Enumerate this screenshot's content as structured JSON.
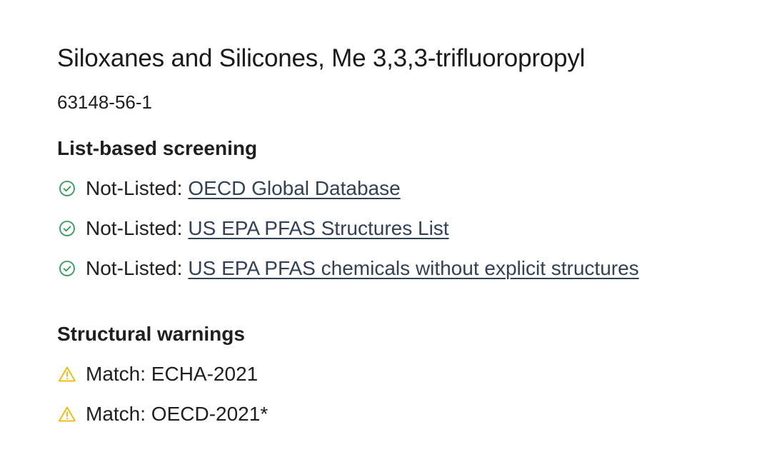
{
  "substance": {
    "name": "Siloxanes and Silicones, Me 3,3,3-trifluoropropyl",
    "cas": "63148-56-1"
  },
  "list_screening": {
    "heading": "List-based screening",
    "items": [
      {
        "status": "Not-Listed:",
        "link": "OECD Global Database",
        "icon": "check-circle-icon"
      },
      {
        "status": "Not-Listed:",
        "link": "US EPA PFAS Structures List",
        "icon": "check-circle-icon"
      },
      {
        "status": "Not-Listed:",
        "link": "US EPA PFAS chemicals without explicit structures",
        "icon": "check-circle-icon"
      }
    ]
  },
  "structural_warnings": {
    "heading": "Structural warnings",
    "items": [
      {
        "text": "Match: ECHA-2021",
        "icon": "warning-triangle-icon"
      },
      {
        "text": "Match: OECD-2021*",
        "icon": "warning-triangle-icon"
      }
    ]
  },
  "colors": {
    "check": "#2f9e5c",
    "warning": "#f2b705",
    "link": "#334155"
  }
}
